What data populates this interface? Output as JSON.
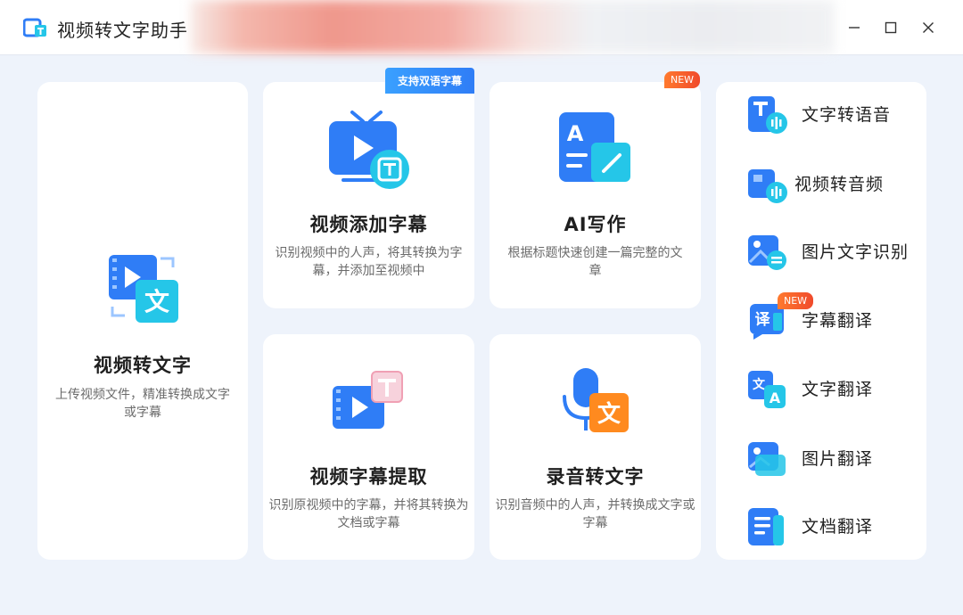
{
  "app": {
    "title": "视频转文字助手"
  },
  "window": {
    "minimize": "—",
    "maximize": "☐",
    "close": "✕"
  },
  "cards": {
    "video_to_text": {
      "title": "视频转文字",
      "desc": "上传视频文件，精准转换成文字或字幕",
      "icon": "video-to-text-icon"
    },
    "add_subtitles": {
      "title": "视频添加字幕",
      "desc": "识别视频中的人声，将其转换为字幕，并添加至视频中",
      "badge": "支持双语字幕",
      "icon": "tv-subtitle-icon"
    },
    "ai_writing": {
      "title": "AI写作",
      "desc": "根据标题快速创建一篇完整的文章",
      "badge": "NEW",
      "icon": "document-edit-icon"
    },
    "extract_subtitles": {
      "title": "视频字幕提取",
      "desc": "识别原视频中的字幕，并将其转换为文档或字幕",
      "icon": "subtitle-extract-icon"
    },
    "audio_to_text": {
      "title": "录音转文字",
      "desc": "识别音频中的人声，并转换成文字或字幕",
      "icon": "microphone-text-icon"
    }
  },
  "side": {
    "items": [
      {
        "label": "文字转语音",
        "icon": "text-to-speech-icon"
      },
      {
        "label": "视频转音频",
        "icon": "video-to-audio-icon"
      },
      {
        "label": "图片文字识别",
        "icon": "image-ocr-icon"
      },
      {
        "label": "字幕翻译",
        "icon": "subtitle-translate-icon",
        "badge": "NEW"
      },
      {
        "label": "文字翻译",
        "icon": "text-translate-icon"
      },
      {
        "label": "图片翻译",
        "icon": "image-translate-icon"
      },
      {
        "label": "文档翻译",
        "icon": "document-translate-icon"
      }
    ]
  },
  "colors": {
    "primary": "#2f7df6",
    "accent_cyan": "#25c6e8",
    "new_badge": "#f04a2b",
    "audio_orange": "#ff8a1f"
  }
}
